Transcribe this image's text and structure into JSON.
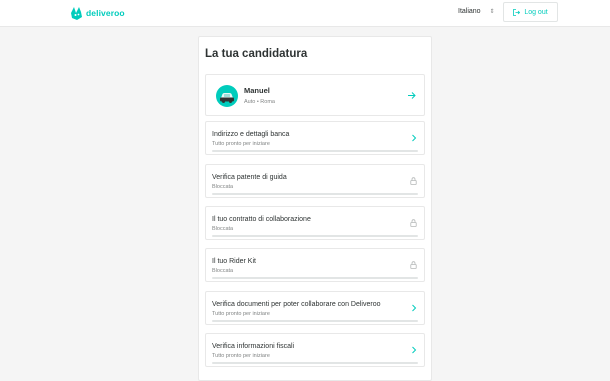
{
  "brand": {
    "name": "deliveroo",
    "color": "#00ccbc"
  },
  "header": {
    "language": "Italiano",
    "logout_label": "Log out"
  },
  "main": {
    "title": "La tua candidatura",
    "rider": {
      "name": "Manuel",
      "details": "Auto • Roma",
      "icon": "arrow-right-icon"
    },
    "steps": [
      {
        "label": "Indirizzo e dettagli banca",
        "status": "Tutto pronto per iniziare",
        "icon": "chevron-right-icon"
      },
      {
        "label": "Verifica patente di guida",
        "status": "Bloccata",
        "icon": "lock-icon"
      },
      {
        "label": "Il tuo contratto di collaborazione",
        "status": "Bloccata",
        "icon": "lock-icon"
      },
      {
        "label": "Il tuo Rider Kit",
        "status": "Bloccata",
        "icon": "lock-icon"
      },
      {
        "label": "Verifica documenti per poter collaborare con Deliveroo",
        "status": "Tutto pronto per iniziare",
        "icon": "chevron-right-icon"
      },
      {
        "label": "Verifica informazioni fiscali",
        "status": "Tutto pronto per iniziare",
        "icon": "chevron-right-icon"
      }
    ]
  }
}
